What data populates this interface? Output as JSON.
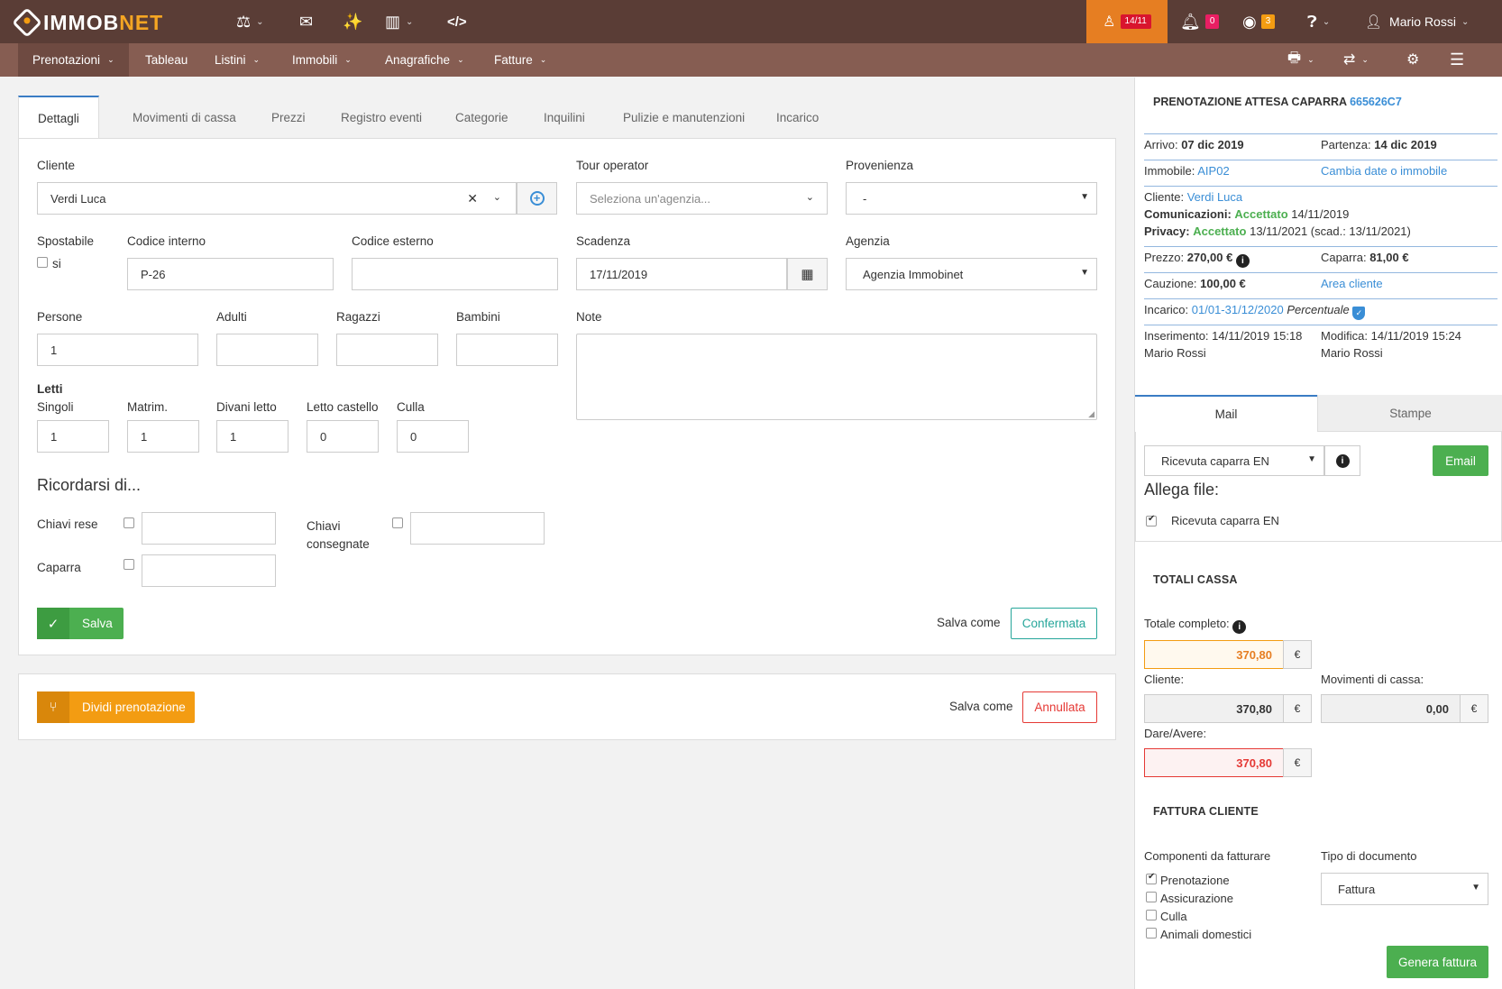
{
  "brand": {
    "left": "IMMO",
    "highlight_o": "B",
    "right": "NET"
  },
  "topbar": {
    "arrivals_badge": "14/11",
    "notifications_count": "0",
    "feed_count": "3",
    "user_name": "Mario Rossi",
    "icons": [
      "scale-icon",
      "envelope-icon",
      "magic-wand-icon",
      "bar-chart-icon",
      "code-icon"
    ]
  },
  "nav": {
    "items": [
      {
        "label": "Prenotazioni",
        "dropdown": true
      },
      {
        "label": "Tableau",
        "dropdown": false
      },
      {
        "label": "Listini",
        "dropdown": true
      },
      {
        "label": "Immobili",
        "dropdown": true
      },
      {
        "label": "Anagrafiche",
        "dropdown": true
      },
      {
        "label": "Fatture",
        "dropdown": true
      }
    ]
  },
  "tabs": [
    "Dettagli",
    "Movimenti di cassa",
    "Prezzi",
    "Registro eventi",
    "Categorie",
    "Inquilini",
    "Pulizie e manutenzioni",
    "Incarico"
  ],
  "form": {
    "cliente_label": "Cliente",
    "cliente_value": "Verdi Luca",
    "tour_operator_label": "Tour operator",
    "tour_operator_placeholder": "Seleziona un'agenzia...",
    "provenienza_label": "Provenienza",
    "provenienza_value": "-",
    "spostabile_label": "Spostabile",
    "spostabile_option": "si",
    "codice_interno_label": "Codice interno",
    "codice_interno_value": "P-26",
    "codice_esterno_label": "Codice esterno",
    "codice_esterno_value": "",
    "scadenza_label": "Scadenza",
    "scadenza_value": "17/11/2019",
    "agenzia_label": "Agenzia",
    "agenzia_value": "Agenzia Immobinet",
    "persone_label": "Persone",
    "persone_value": "1",
    "adulti_label": "Adulti",
    "ragazzi_label": "Ragazzi",
    "bambini_label": "Bambini",
    "note_label": "Note",
    "letti_title": "Letti",
    "singoli_label": "Singoli",
    "singoli_value": "1",
    "matrim_label": "Matrim.",
    "matrim_value": "1",
    "divani_label": "Divani letto",
    "divani_value": "1",
    "castello_label": "Letto castello",
    "castello_value": "0",
    "culla_label": "Culla",
    "culla_value": "0",
    "ricordarsi_title": "Ricordarsi di...",
    "chiavi_rese_label": "Chiavi rese",
    "chiavi_consegnate_label": "Chiavi consegnate",
    "caparra_label": "Caparra",
    "salva_label": "Salva",
    "salva_come_label": "Salva come",
    "confermata_label": "Confermata"
  },
  "split": {
    "dividi_label": "Dividi prenotazione",
    "salva_come_label": "Salva come",
    "annullata_label": "Annullata"
  },
  "side": {
    "title_prefix": "PRENOTAZIONE ATTESA CAPARRA",
    "code": "665626C7",
    "arrivo_label": "Arrivo:",
    "arrivo_value": "07 dic 2019",
    "partenza_label": "Partenza:",
    "partenza_value": "14 dic 2019",
    "immobile_label": "Immobile:",
    "immobile_value": "AIP02",
    "cambia_link": "Cambia date o immobile",
    "cliente_label": "Cliente:",
    "cliente_value": "Verdi Luca",
    "comunicazioni_label": "Comunicazioni:",
    "comunicazioni_status": "Accettato",
    "comunicazioni_date": "14/11/2019",
    "privacy_label": "Privacy:",
    "privacy_status": "Accettato",
    "privacy_date": "13/11/2021 (scad.: 13/11/2021)",
    "prezzo_label": "Prezzo:",
    "prezzo_value": "270,00 €",
    "caparra_label": "Caparra:",
    "caparra_value": "81,00 €",
    "cauzione_label": "Cauzione:",
    "cauzione_value": "100,00 €",
    "area_cliente_link": "Area cliente",
    "incarico_label": "Incarico:",
    "incarico_value": "01/01-31/12/2020",
    "incarico_type": "Percentuale",
    "inserimento_label": "Inserimento:",
    "inserimento_value": "14/11/2019 15:18",
    "inserimento_user": "Mario Rossi",
    "modifica_label": "Modifica:",
    "modifica_value": "14/11/2019 15:24",
    "modifica_user": "Mario Rossi",
    "tab_mail": "Mail",
    "tab_stampe": "Stampe",
    "template_value": "Ricevuta caparra EN",
    "email_button": "Email",
    "allega_title": "Allega file:",
    "allega_item": "Ricevuta caparra EN",
    "totali_title": "TOTALI CASSA",
    "totale_label": "Totale completo:",
    "totale_value": "370,80",
    "cliente_tot_label": "Cliente:",
    "cliente_tot_value": "370,80",
    "movimenti_label": "Movimenti di cassa:",
    "movimenti_value": "0,00",
    "dare_label": "Dare/Avere:",
    "dare_value": "370,80",
    "currency": "€",
    "fattura_title": "FATTURA CLIENTE",
    "componenti_label": "Componenti da fatturare",
    "componenti": [
      "Prenotazione",
      "Assicurazione",
      "Culla",
      "Animali domestici"
    ],
    "tipo_doc_label": "Tipo di documento",
    "tipo_doc_value": "Fattura",
    "genera_button": "Genera fattura"
  },
  "colors": {
    "topbar": "#5a3d36",
    "navbar": "#865d52",
    "accent": "#e67e22",
    "green": "#4caf50",
    "link": "#3a8ed6",
    "danger": "#e53935"
  }
}
